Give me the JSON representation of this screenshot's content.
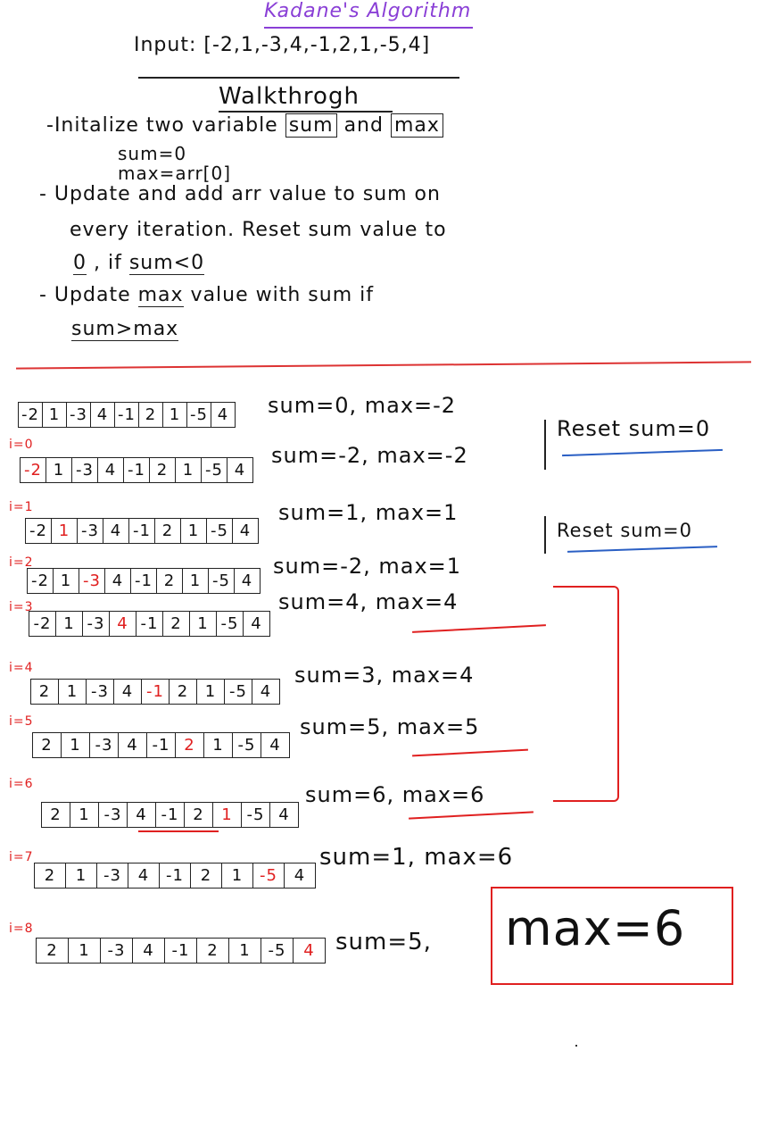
{
  "title": "Kadane's Algorithm",
  "input_line": "Input: [-2,1,-3,4,-1,2,1,-5,4]",
  "walkthrough": "Walkthrogh",
  "notes": {
    "n1_prefix": "-Initalize two variable",
    "n1_sum": "sum",
    "n1_and": "and",
    "n1_max": "max",
    "init_sum": "sum=0",
    "init_max": "max=arr[0]",
    "n2_line1": "- Update and add arr value to sum on",
    "n2_line2": "every iteration. Reset sum value to",
    "n2_zero": "0",
    "n2_if": ", if",
    "n2_cond": "sum<0",
    "n3_prefix": "- Update",
    "n3_max": "max",
    "n3_rest": "value with sum if",
    "n3_cond": "sum>max"
  },
  "rows": [
    {
      "label": "",
      "values": [
        "-2",
        "1",
        "-3",
        "4",
        "-1",
        "2",
        "1",
        "-5",
        "4"
      ],
      "highlight": -1,
      "status": "sum=0, max=-2"
    },
    {
      "label": "i=0",
      "values": [
        "-2",
        "1",
        "-3",
        "4",
        "-1",
        "2",
        "1",
        "-5",
        "4"
      ],
      "highlight": 0,
      "status": "sum=-2, max=-2"
    },
    {
      "label": "i=1",
      "values": [
        "-2",
        "1",
        "-3",
        "4",
        "-1",
        "2",
        "1",
        "-5",
        "4"
      ],
      "highlight": 1,
      "status": "sum=1, max=1"
    },
    {
      "label": "i=2",
      "values": [
        "-2",
        "1",
        "-3",
        "4",
        "-1",
        "2",
        "1",
        "-5",
        "4"
      ],
      "highlight": 2,
      "status": "sum=-2, max=1"
    },
    {
      "label": "i=3",
      "values": [
        "-2",
        "1",
        "-3",
        "4",
        "-1",
        "2",
        "1",
        "-5",
        "4"
      ],
      "highlight": 3,
      "status": "sum=4, max=4"
    },
    {
      "label": "i=4",
      "values": [
        "2",
        "1",
        "-3",
        "4",
        "-1",
        "2",
        "1",
        "-5",
        "4"
      ],
      "highlight": 4,
      "status": "sum=3, max=4"
    },
    {
      "label": "i=5",
      "values": [
        "2",
        "1",
        "-3",
        "4",
        "-1",
        "2",
        "1",
        "-5",
        "4"
      ],
      "highlight": 5,
      "status": "sum=5, max=5"
    },
    {
      "label": "i=6",
      "values": [
        "2",
        "1",
        "-3",
        "4",
        "-1",
        "2",
        "1",
        "-5",
        "4"
      ],
      "highlight": 6,
      "status": "sum=6, max=6"
    },
    {
      "label": "i=7",
      "values": [
        "2",
        "1",
        "-3",
        "4",
        "-1",
        "2",
        "1",
        "-5",
        "4"
      ],
      "highlight": 7,
      "status": "sum=1, max=6"
    },
    {
      "label": "i=8",
      "values": [
        "2",
        "1",
        "-3",
        "4",
        "-1",
        "2",
        "1",
        "-5",
        "4"
      ],
      "highlight": 8,
      "status": "sum=5,"
    }
  ],
  "reset1": "Reset sum=0",
  "reset2": "Reset sum=0",
  "final": "max=6",
  "colors": {
    "title": "#8a3fd6",
    "highlight": "#e02020",
    "reset_underline": "#2a5fc4"
  }
}
